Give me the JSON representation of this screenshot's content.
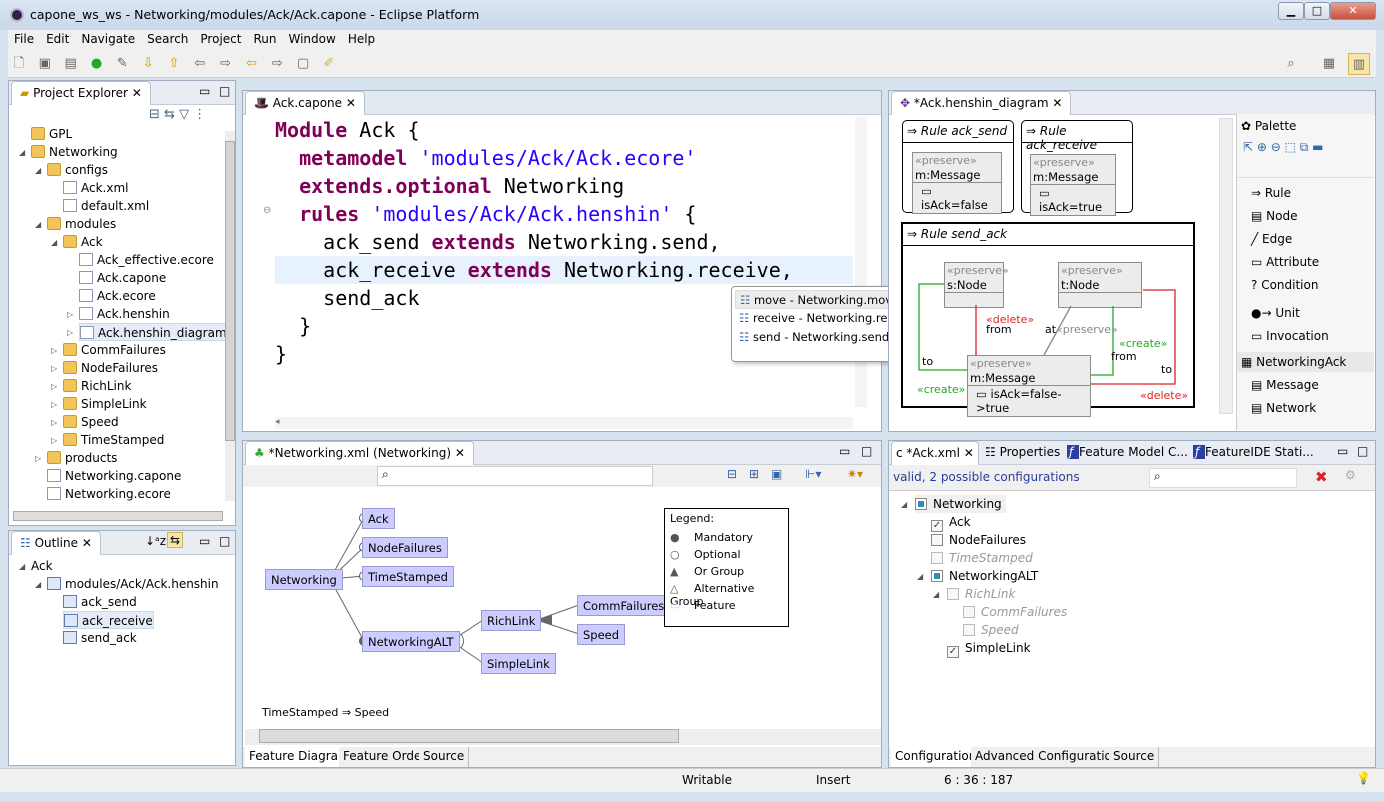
{
  "window": {
    "title": "capone_ws_ws - Networking/modules/Ack/Ack.capone - Eclipse Platform"
  },
  "menu": [
    "File",
    "Edit",
    "Navigate",
    "Search",
    "Project",
    "Run",
    "Window",
    "Help"
  ],
  "project_explorer": {
    "title": "Project Explorer",
    "items": [
      {
        "label": "GPL",
        "depth": 0,
        "kind": "project",
        "tw": ""
      },
      {
        "label": "Networking",
        "depth": 0,
        "kind": "project",
        "tw": "open"
      },
      {
        "label": "configs",
        "depth": 1,
        "kind": "folder",
        "tw": "open"
      },
      {
        "label": "Ack.xml",
        "depth": 2,
        "kind": "file",
        "tw": ""
      },
      {
        "label": "default.xml",
        "depth": 2,
        "kind": "file",
        "tw": ""
      },
      {
        "label": "modules",
        "depth": 1,
        "kind": "folder",
        "tw": "open"
      },
      {
        "label": "Ack",
        "depth": 2,
        "kind": "folder",
        "tw": "open"
      },
      {
        "label": "Ack_effective.ecore",
        "depth": 3,
        "kind": "file",
        "tw": ""
      },
      {
        "label": "Ack.capone",
        "depth": 3,
        "kind": "file",
        "tw": ""
      },
      {
        "label": "Ack.ecore",
        "depth": 3,
        "kind": "file",
        "tw": ""
      },
      {
        "label": "Ack.henshin",
        "depth": 3,
        "kind": "file",
        "tw": "closed"
      },
      {
        "label": "Ack.henshin_diagram",
        "depth": 3,
        "kind": "file",
        "tw": "closed",
        "selected": true
      },
      {
        "label": "CommFailures",
        "depth": 2,
        "kind": "folder",
        "tw": "closed"
      },
      {
        "label": "NodeFailures",
        "depth": 2,
        "kind": "folder",
        "tw": "closed"
      },
      {
        "label": "RichLink",
        "depth": 2,
        "kind": "folder",
        "tw": "closed"
      },
      {
        "label": "SimpleLink",
        "depth": 2,
        "kind": "folder",
        "tw": "closed"
      },
      {
        "label": "Speed",
        "depth": 2,
        "kind": "folder",
        "tw": "closed"
      },
      {
        "label": "TimeStamped",
        "depth": 2,
        "kind": "folder",
        "tw": "closed"
      },
      {
        "label": "products",
        "depth": 1,
        "kind": "folder",
        "tw": "closed"
      },
      {
        "label": "Networking.capone",
        "depth": 1,
        "kind": "file",
        "tw": ""
      },
      {
        "label": "Networking.ecore",
        "depth": 1,
        "kind": "file",
        "tw": ""
      }
    ]
  },
  "outline": {
    "title": "Outline",
    "items": [
      {
        "label": "Ack",
        "depth": 0,
        "tw": "open"
      },
      {
        "label": "modules/Ack/Ack.henshin",
        "depth": 1,
        "tw": "open"
      },
      {
        "label": "ack_send",
        "depth": 2,
        "tw": ""
      },
      {
        "label": "ack_receive",
        "depth": 2,
        "tw": "",
        "selected": true
      },
      {
        "label": "send_ack",
        "depth": 2,
        "tw": ""
      }
    ]
  },
  "editor": {
    "tab": "Ack.capone",
    "lines": [
      [
        {
          "t": "Module",
          "c": "kw"
        },
        {
          "t": " Ack {",
          "c": "plain"
        }
      ],
      [
        {
          "t": "  metamodel",
          "c": "kw"
        },
        {
          "t": " ",
          "c": "plain"
        },
        {
          "t": "'modules/Ack/Ack.ecore'",
          "c": "str"
        }
      ],
      [
        {
          "t": "  extends.optional",
          "c": "kw"
        },
        {
          "t": " Networking",
          "c": "plain"
        }
      ],
      [
        {
          "t": "  rules",
          "c": "kw"
        },
        {
          "t": " ",
          "c": "plain"
        },
        {
          "t": "'modules/Ack/Ack.henshin'",
          "c": "str"
        },
        {
          "t": " {",
          "c": "plain"
        }
      ],
      [
        {
          "t": "    ack_send ",
          "c": "plain"
        },
        {
          "t": "extends",
          "c": "kw"
        },
        {
          "t": " Networking.send,",
          "c": "plain"
        }
      ],
      [
        {
          "t": "    ack_receive ",
          "c": "plain"
        },
        {
          "t": "extends",
          "c": "kw"
        },
        {
          "t": " Networking.receive,",
          "c": "plain"
        }
      ],
      [
        {
          "t": "    send_ack",
          "c": "plain"
        }
      ],
      [
        {
          "t": "  }",
          "c": "plain"
        }
      ],
      [
        {
          "t": "}",
          "c": "plain"
        }
      ]
    ],
    "current_line": 6,
    "completion": [
      "move - Networking.move",
      "receive - Networking.receive",
      "send - Networking.send"
    ]
  },
  "henshin": {
    "tab": "*Ack.henshin_diagram",
    "rules": [
      {
        "title": "Rule ack_send",
        "node": {
          "stereo": "«preserve»",
          "name": "m:Message",
          "attr": "isAck=false"
        }
      },
      {
        "title": "Rule ack_receive",
        "node": {
          "stereo": "«preserve»",
          "name": "m:Message",
          "attr": "isAck=true"
        }
      },
      {
        "title": "Rule send_ack",
        "nodes": [
          {
            "stereo": "«preserve»",
            "name": "s:Node"
          },
          {
            "stereo": "«preserve»",
            "name": "t:Node"
          },
          {
            "stereo": "«preserve»",
            "name": "m:Message",
            "attr": "isAck=false->true"
          }
        ],
        "edge_labels": {
          "delete1": "«delete»",
          "from1": "from",
          "at": "at",
          "preserve": "«preserve»",
          "create1": "«create»",
          "from2": "from",
          "to1": "to",
          "create2": "«create»",
          "to2": "to",
          "delete2": "«delete»"
        }
      }
    ],
    "palette": {
      "title": "Palette",
      "tools": [
        "Rule",
        "Node",
        "Edge",
        "Attribute",
        "Condition",
        "Unit",
        "Invocation"
      ],
      "group": "NetworkingAck",
      "group_items": [
        "Message",
        "Network"
      ]
    },
    "colors": {
      "create": "#22aa22",
      "delete": "#dd2222",
      "preserve": "#888888"
    }
  },
  "feature_model": {
    "tab": "*Networking.xml (Networking)",
    "features": {
      "root": "Networking",
      "ack": "Ack",
      "nodefailures": "NodeFailures",
      "timestamped": "TimeStamped",
      "alt": "NetworkingALT",
      "richlink": "RichLink",
      "simplelink": "SimpleLink",
      "commfailures": "CommFailures",
      "speed": "Speed"
    },
    "legend": {
      "title": "Legend:",
      "items": [
        "Mandatory",
        "Optional",
        "Or Group",
        "Alternative Group",
        "Feature"
      ]
    },
    "constraint": "TimeStamped ⇒ Speed",
    "bottom_tabs": [
      "Feature Diagram",
      "Feature Order",
      "Source"
    ],
    "feature_color": "#ccccff"
  },
  "configuration": {
    "tabs": [
      "*Ack.xml",
      "Properties",
      "Feature Model C...",
      "FeatureIDE Stati..."
    ],
    "status": "valid, 2 possible configurations",
    "items": [
      {
        "label": "Networking",
        "depth": 0,
        "state": "root",
        "tw": "open"
      },
      {
        "label": "Ack",
        "depth": 1,
        "state": "checked"
      },
      {
        "label": "NodeFailures",
        "depth": 1,
        "state": "unchecked"
      },
      {
        "label": "TimeStamped",
        "depth": 1,
        "state": "disabled"
      },
      {
        "label": "NetworkingALT",
        "depth": 1,
        "state": "root",
        "tw": "open"
      },
      {
        "label": "RichLink",
        "depth": 2,
        "state": "disabled",
        "tw": "open"
      },
      {
        "label": "CommFailures",
        "depth": 3,
        "state": "disabled"
      },
      {
        "label": "Speed",
        "depth": 3,
        "state": "disabled"
      },
      {
        "label": "SimpleLink",
        "depth": 2,
        "state": "checked"
      }
    ],
    "bottom_tabs": [
      "Configuration",
      "Advanced Configuration",
      "Source"
    ]
  },
  "statusbar": {
    "mode": "Writable",
    "insert": "Insert",
    "position": "6 : 36 : 187"
  }
}
